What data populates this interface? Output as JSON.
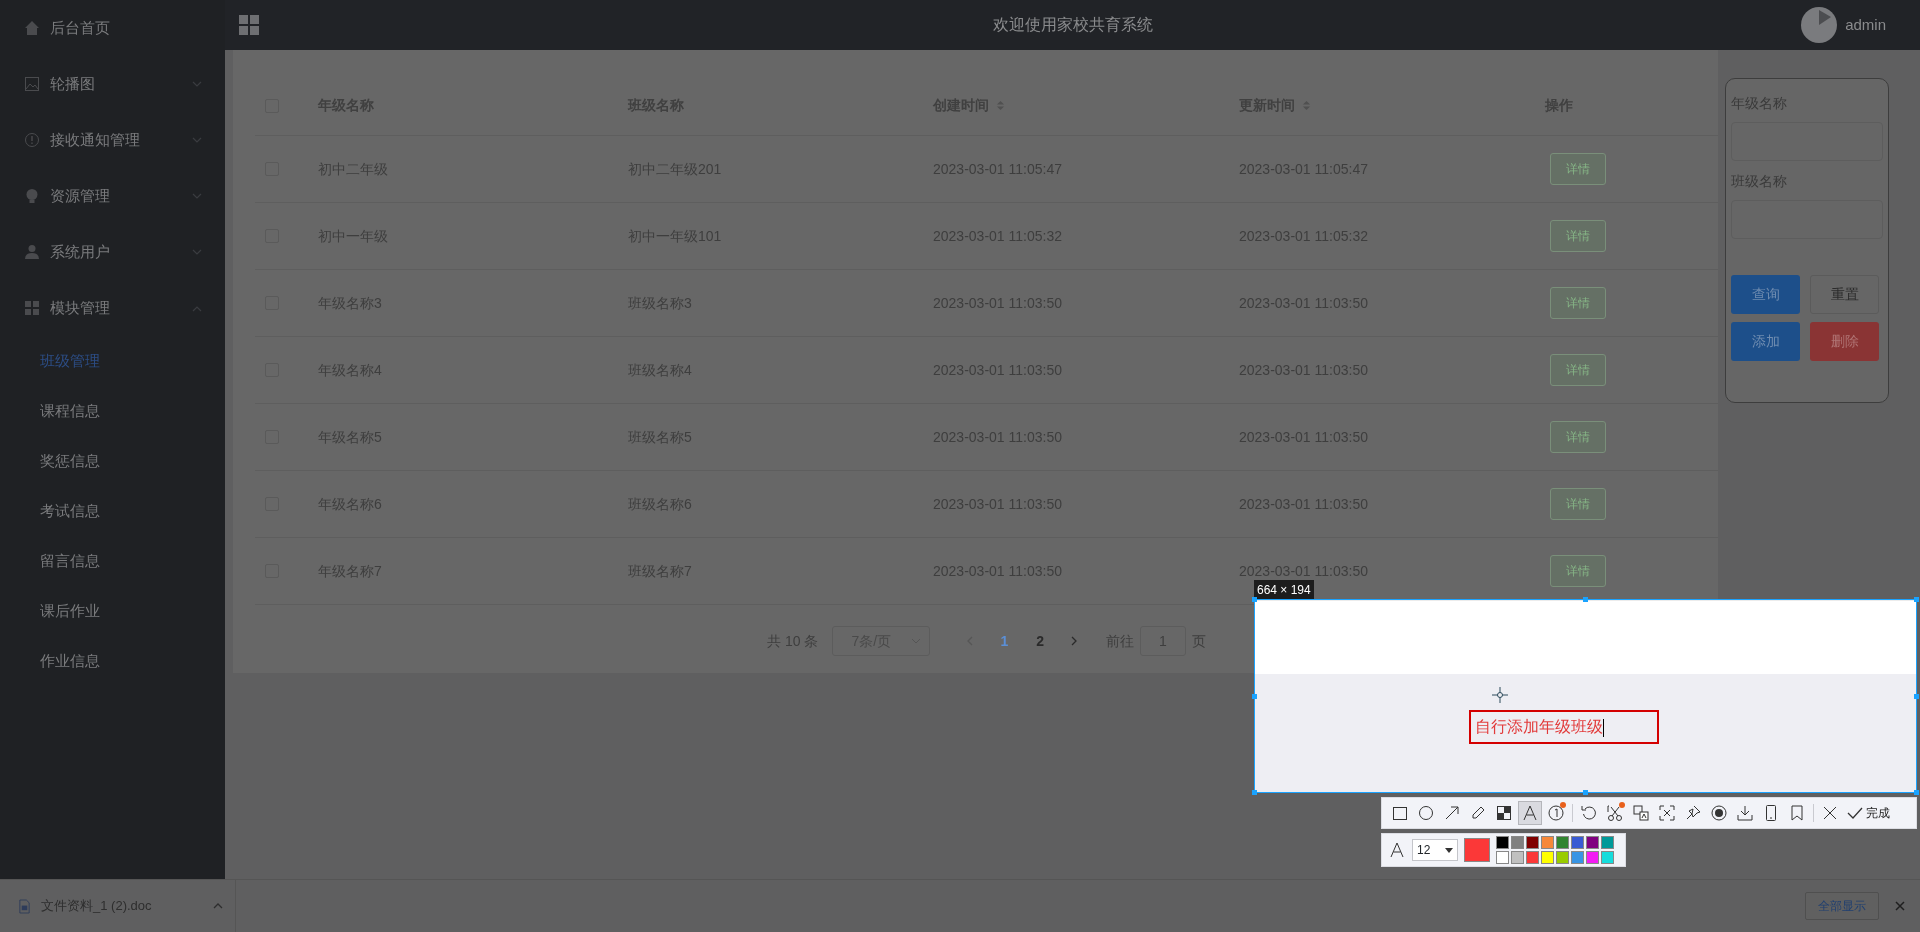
{
  "sidebar": {
    "items": [
      {
        "label": "后台首页",
        "kind": "link"
      },
      {
        "label": "轮播图",
        "kind": "menu",
        "expanded": false
      },
      {
        "label": "接收通知管理",
        "kind": "menu",
        "expanded": false
      },
      {
        "label": "资源管理",
        "kind": "menu",
        "expanded": false
      },
      {
        "label": "系统用户",
        "kind": "menu",
        "expanded": false
      },
      {
        "label": "模块管理",
        "kind": "menu",
        "expanded": true,
        "children": [
          {
            "label": "班级管理",
            "selected": true
          },
          {
            "label": "课程信息",
            "selected": false
          },
          {
            "label": "奖惩信息",
            "selected": false
          },
          {
            "label": "考试信息",
            "selected": false
          },
          {
            "label": "留言信息",
            "selected": false
          },
          {
            "label": "课后作业",
            "selected": false
          },
          {
            "label": "作业信息",
            "selected": false
          }
        ]
      }
    ]
  },
  "header": {
    "title": "欢迎使用家校共育系统",
    "user": "admin"
  },
  "table": {
    "all_checked": false,
    "columns": [
      {
        "label": "年级名称",
        "sortable": false
      },
      {
        "label": "班级名称",
        "sortable": false
      },
      {
        "label": "创建时间",
        "sortable": true
      },
      {
        "label": "更新时间",
        "sortable": true
      },
      {
        "label": "操作",
        "sortable": false
      }
    ],
    "rows": [
      {
        "checked": false,
        "cells": [
          "初中二年级",
          "初中二年级201",
          "2023-03-01 11:05:47",
          "2023-03-01 11:05:47"
        ],
        "action": "详情"
      },
      {
        "checked": false,
        "cells": [
          "初中一年级",
          "初中一年级101",
          "2023-03-01 11:05:32",
          "2023-03-01 11:05:32"
        ],
        "action": "详情"
      },
      {
        "checked": false,
        "cells": [
          "年级名称3",
          "班级名称3",
          "2023-03-01 11:03:50",
          "2023-03-01 11:03:50"
        ],
        "action": "详情"
      },
      {
        "checked": false,
        "cells": [
          "年级名称4",
          "班级名称4",
          "2023-03-01 11:03:50",
          "2023-03-01 11:03:50"
        ],
        "action": "详情"
      },
      {
        "checked": false,
        "cells": [
          "年级名称5",
          "班级名称5",
          "2023-03-01 11:03:50",
          "2023-03-01 11:03:50"
        ],
        "action": "详情"
      },
      {
        "checked": false,
        "cells": [
          "年级名称6",
          "班级名称6",
          "2023-03-01 11:03:50",
          "2023-03-01 11:03:50"
        ],
        "action": "详情"
      },
      {
        "checked": false,
        "cells": [
          "年级名称7",
          "班级名称7",
          "2023-03-01 11:03:50",
          "2023-03-01 11:03:50"
        ],
        "action": "详情"
      }
    ]
  },
  "pagination": {
    "total": "共 10 条",
    "page_size": "7条/页",
    "pages": [
      {
        "label": "1",
        "selected": true
      },
      {
        "label": "2",
        "selected": false
      }
    ],
    "goto_label": "前往",
    "goto_value": "1",
    "page_unit": "页"
  },
  "filter_panel": {
    "fields": [
      {
        "label": "年级名称"
      },
      {
        "label": "班级名称"
      }
    ],
    "buttons": [
      {
        "label": "查询",
        "kind": "primary"
      },
      {
        "label": "重置",
        "kind": "default"
      },
      {
        "label": "添加",
        "kind": "primary"
      },
      {
        "label": "删除",
        "kind": "danger"
      }
    ]
  },
  "download_bar": {
    "file": "文件资料_1 (2).doc",
    "show_all": "全部显示"
  },
  "capture": {
    "size_label": "664 × 194",
    "annotation": "自行添加年级班级",
    "tools": [
      {
        "kind": "rectangle",
        "selected": false,
        "badge": false
      },
      {
        "kind": "ellipse",
        "selected": false,
        "badge": false
      },
      {
        "kind": "arrow",
        "selected": false,
        "badge": false
      },
      {
        "kind": "pencil",
        "selected": false,
        "badge": false
      },
      {
        "kind": "mosaic",
        "selected": false,
        "badge": false
      },
      {
        "kind": "text",
        "selected": true,
        "badge": false
      },
      {
        "kind": "number",
        "selected": false,
        "badge": true
      },
      {
        "kind": "undo",
        "selected": false,
        "badge": false
      },
      {
        "kind": "scissors",
        "selected": false,
        "badge": true
      },
      {
        "kind": "translate",
        "selected": false,
        "badge": false
      },
      {
        "kind": "scan",
        "selected": false,
        "badge": false
      },
      {
        "kind": "pin",
        "selected": false,
        "badge": false
      },
      {
        "kind": "record",
        "selected": false,
        "badge": false
      },
      {
        "kind": "download",
        "selected": false,
        "badge": false
      },
      {
        "kind": "phone",
        "selected": false,
        "badge": false
      },
      {
        "kind": "bookmark",
        "selected": false,
        "badge": false
      },
      {
        "kind": "close",
        "selected": false,
        "badge": false
      }
    ],
    "done_label": "完成",
    "font_size": "12",
    "current": {
      "color": "#fb3838"
    },
    "palette": [
      {
        "color": "#000000"
      },
      {
        "color": "#808080"
      },
      {
        "color": "#800000"
      },
      {
        "color": "#f7883a"
      },
      {
        "color": "#308430"
      },
      {
        "color": "#385ad3"
      },
      {
        "color": "#800080"
      },
      {
        "color": "#009999"
      },
      {
        "color": "#ffffff"
      },
      {
        "color": "#c0c0c0"
      },
      {
        "color": "#fb3838"
      },
      {
        "color": "#ffff00"
      },
      {
        "color": "#99cc00"
      },
      {
        "color": "#3894e4"
      },
      {
        "color": "#f31bf3"
      },
      {
        "color": "#16dcdc"
      }
    ]
  }
}
